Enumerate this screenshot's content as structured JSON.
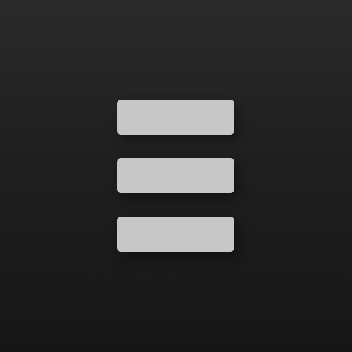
{
  "icon": {
    "name": "hamburger-menu-icon",
    "bar_count": 3,
    "colors": {
      "background_top": "#2a2a2a",
      "background_bottom": "#161616",
      "bar": "#c7c7c7"
    }
  }
}
